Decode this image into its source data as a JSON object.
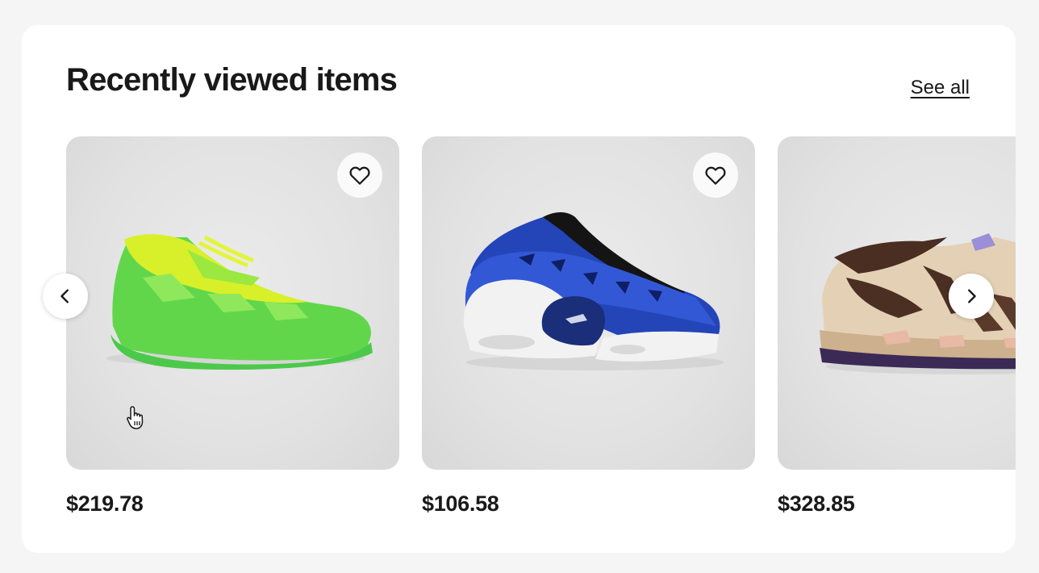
{
  "section": {
    "title": "Recently viewed items",
    "see_all_label": "See all"
  },
  "items": [
    {
      "price": "$219.78",
      "image_desc": "green-yellow basketball sneaker",
      "favorite_icon": "heart-outline-icon"
    },
    {
      "price": "$106.58",
      "image_desc": "blue-white Reebok basketball sneaker",
      "favorite_icon": "heart-outline-icon"
    },
    {
      "price": "$328.85",
      "image_desc": "beige-brown adidas sneaker",
      "favorite_icon": "heart-outline-icon"
    }
  ],
  "navigation": {
    "prev_icon": "chevron-left-icon",
    "next_icon": "chevron-right-icon"
  },
  "colors": {
    "page_bg": "#f5f5f5",
    "card_bg": "#ffffff",
    "text": "#191919",
    "image_bg": "#e2e2e2"
  }
}
